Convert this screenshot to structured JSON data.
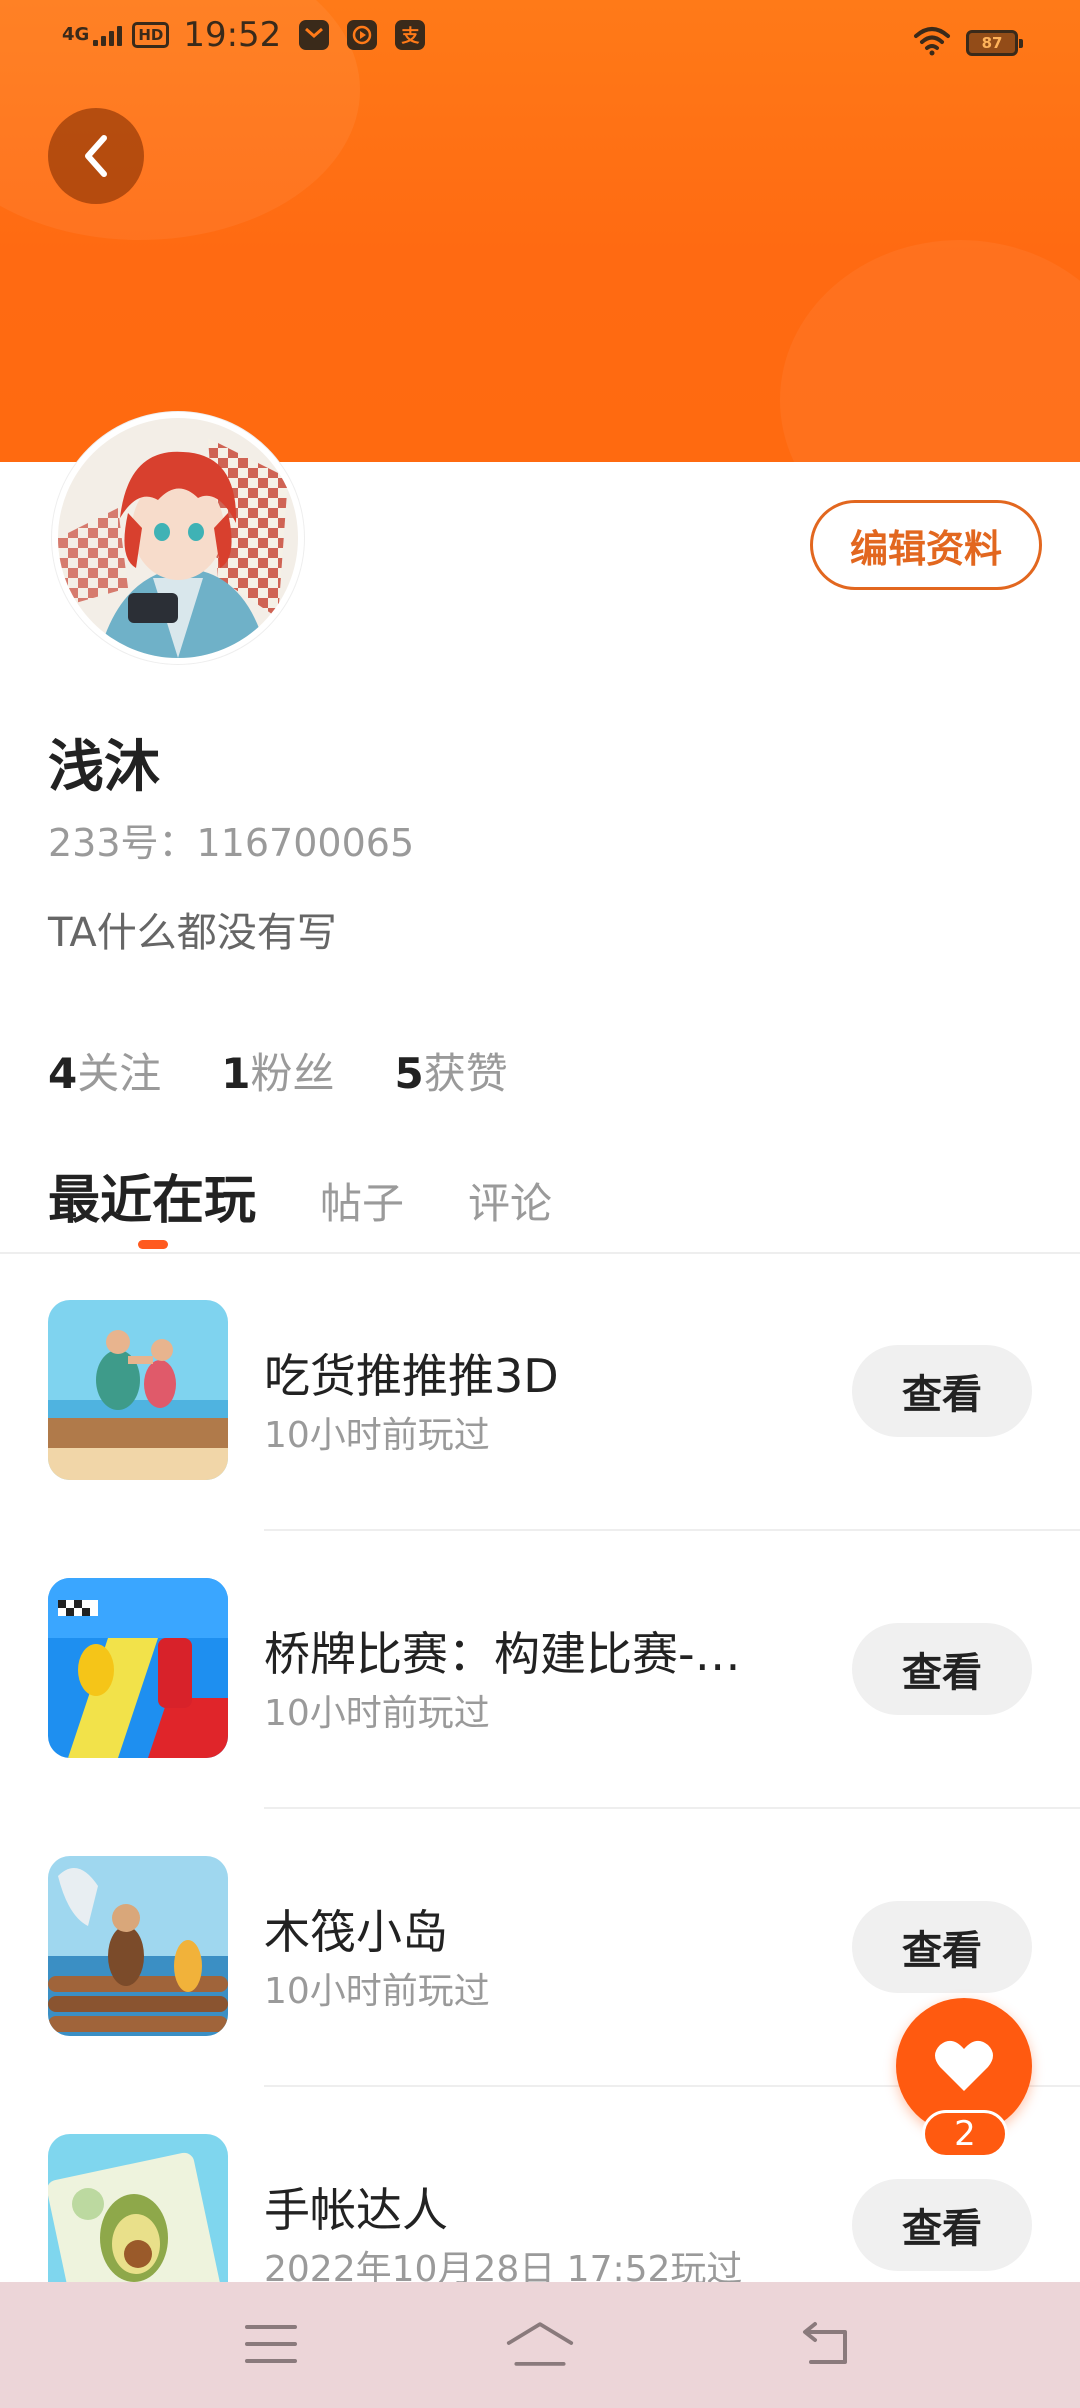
{
  "status_bar": {
    "network": "4G",
    "hd": "HD",
    "time": "19:52",
    "app_icons": [
      "mail-app-icon",
      "video-app-icon",
      "alipay-icon"
    ],
    "alipay_char": "支",
    "battery": "87"
  },
  "profile": {
    "edit_label": "编辑资料",
    "name": "浅沐",
    "id_text": "233号：116700065",
    "bio": "TA什么都没有写",
    "stats": [
      {
        "num": "4",
        "label": "关注"
      },
      {
        "num": "1",
        "label": "粉丝"
      },
      {
        "num": "5",
        "label": "获赞"
      }
    ]
  },
  "tabs": [
    {
      "label": "最近在玩",
      "active": true
    },
    {
      "label": "帖子",
      "active": false
    },
    {
      "label": "评论",
      "active": false
    }
  ],
  "games": [
    {
      "name": "吃货推推推3D",
      "time": "10小时前玩过",
      "button": "查看"
    },
    {
      "name": "桥牌比赛：构建比赛-…",
      "time": "10小时前玩过",
      "button": "查看"
    },
    {
      "name": "木筏小岛",
      "time": "10小时前玩过",
      "button": "查看"
    },
    {
      "name": "手帐达人",
      "time": "2022年10月28日 17:52玩过",
      "button": "查看"
    }
  ],
  "like": {
    "count": "2"
  },
  "colors": {
    "accent": "#ff6a12",
    "edit_border": "#e2671f",
    "navbar_bg": "#ecd5d8"
  }
}
